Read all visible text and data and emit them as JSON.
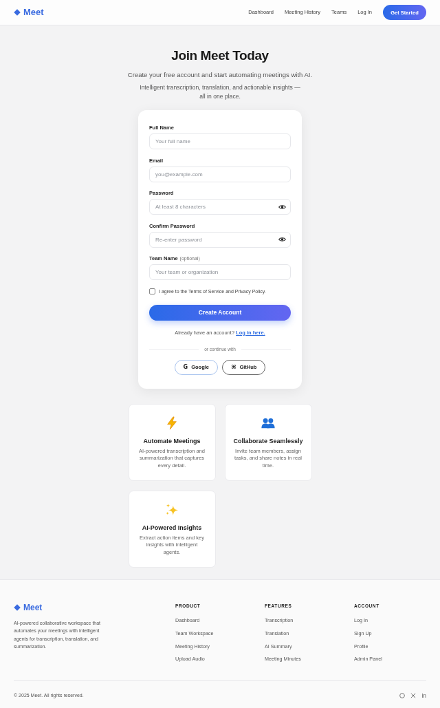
{
  "header": {
    "logo": "Meet",
    "nav": [
      {
        "label": "Dashboard"
      },
      {
        "label": "Meeting History"
      },
      {
        "label": "Teams"
      },
      {
        "label": "Log In"
      }
    ],
    "cta": "Get Started"
  },
  "hero": {
    "title": "Join Meet Today",
    "subtitle": "Create your free account and start automating meetings with AI.",
    "tagline": "Intelligent transcription, translation, and actionable insights — all in one place."
  },
  "form": {
    "fields": [
      {
        "label": "Full Name",
        "placeholder": "Your full name",
        "kind": "text"
      },
      {
        "label": "Email",
        "placeholder": "you@example.com",
        "kind": "text"
      },
      {
        "label": "Password",
        "placeholder": "At least 8 characters",
        "kind": "password"
      },
      {
        "label": "Confirm Password",
        "placeholder": "Re-enter password",
        "kind": "password"
      },
      {
        "label": "Team Name",
        "note": "(optional)",
        "placeholder": "Your team or organization",
        "kind": "text"
      }
    ],
    "agreement": {
      "text": "I agree to the Terms of Service and Privacy Policy.",
      "checked": false
    },
    "submit": "Create Account",
    "login_prompt": "Already have an account?",
    "login_link": "Log in here.",
    "divider": "or continue with",
    "providers": [
      {
        "kind": "google",
        "icon": "G",
        "label": "Google"
      },
      {
        "kind": "github",
        "icon": "⌘",
        "label": "GitHub"
      }
    ]
  },
  "features": [
    {
      "kind": "bolt",
      "title": "Automate Meetings",
      "text": "AI-powered transcription and summarization that captures every detail."
    },
    {
      "kind": "people",
      "title": "Collaborate Seamlessly",
      "text": "Invite team members, assign tasks, and share notes in real time."
    },
    {
      "kind": "sparkles",
      "title": "AI-Powered Insights",
      "text": "Extract action items and key insights with intelligent agents."
    }
  ],
  "footer": {
    "logo": "Meet",
    "description": "AI-powered collaborative workspace that automates your meetings with intelligent agents for transcription, translation, and summarization.",
    "columns": [
      {
        "heading": "PRODUCT",
        "links": [
          "Dashboard",
          "Team Workspace",
          "Meeting History",
          "Upload Audio"
        ]
      },
      {
        "heading": "FEATURES",
        "links": [
          "Transcription",
          "Translation",
          "AI Summary",
          "Meeting Minutes"
        ]
      },
      {
        "heading": "ACCOUNT",
        "links": [
          "Log In",
          "Sign Up",
          "Profile",
          "Admin Panel"
        ]
      }
    ],
    "copyright": "© 2025 Meet. All rights reserved.",
    "social": [
      {
        "kind": "ring"
      },
      {
        "kind": "x"
      },
      {
        "kind": "text",
        "label": "in"
      }
    ]
  }
}
